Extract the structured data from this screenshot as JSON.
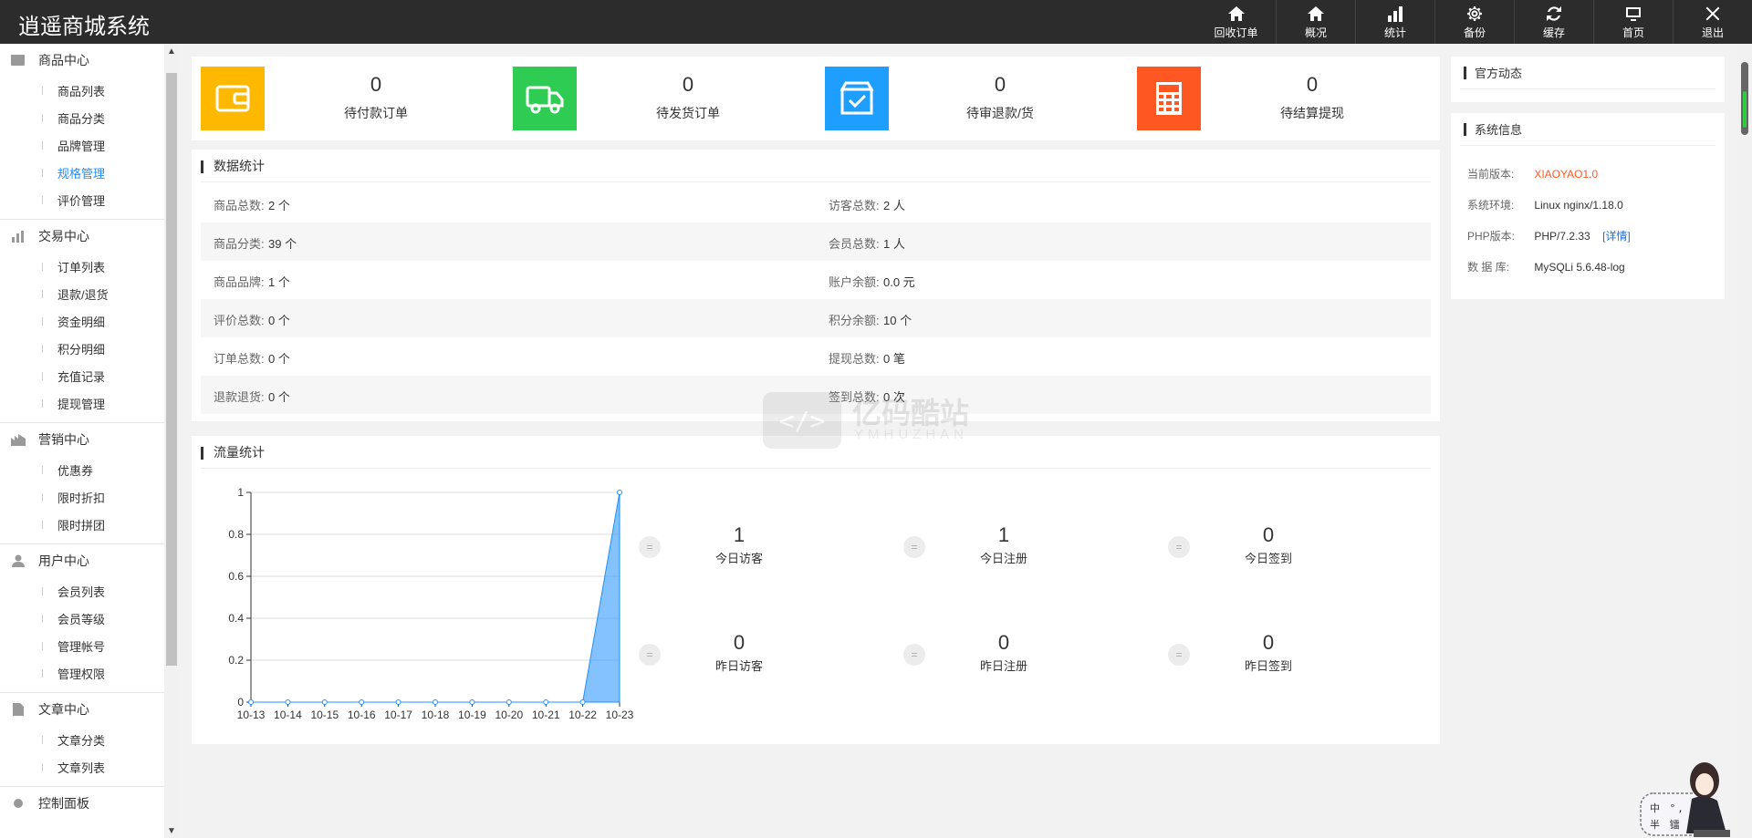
{
  "app": {
    "title": "逍遥商城系统"
  },
  "topnav": [
    {
      "label": "回收订单",
      "icon": "home-icon"
    },
    {
      "label": "概况",
      "icon": "home-icon"
    },
    {
      "label": "统计",
      "icon": "bar-chart-icon"
    },
    {
      "label": "备份",
      "icon": "gear-icon"
    },
    {
      "label": "缓存",
      "icon": "refresh-icon"
    },
    {
      "label": "首页",
      "icon": "monitor-icon"
    },
    {
      "label": "退出",
      "icon": "close-icon"
    }
  ],
  "sidebar": {
    "groups": [
      {
        "title": "商品中心",
        "icon": "goods-icon",
        "items": [
          "商品列表",
          "商品分类",
          "品牌管理",
          "规格管理",
          "评价管理"
        ],
        "active": "规格管理"
      },
      {
        "title": "交易中心",
        "icon": "bar-chart-icon",
        "items": [
          "订单列表",
          "退款/退货",
          "资金明细",
          "积分明细",
          "充值记录",
          "提现管理"
        ]
      },
      {
        "title": "营销中心",
        "icon": "marketing-icon",
        "items": [
          "优惠券",
          "限时折扣",
          "限时拼团"
        ]
      },
      {
        "title": "用户中心",
        "icon": "user-icon",
        "items": [
          "会员列表",
          "会员等级",
          "管理帐号",
          "管理权限"
        ]
      },
      {
        "title": "文章中心",
        "icon": "document-icon",
        "items": [
          "文章分类",
          "文章列表"
        ]
      },
      {
        "title": "控制面板",
        "icon": "gear-icon",
        "items": []
      }
    ]
  },
  "pending": [
    {
      "value": "0",
      "label": "待付款订单",
      "color": "#ffb800",
      "icon": "wallet-icon"
    },
    {
      "value": "0",
      "label": "待发货订单",
      "color": "#2ecc52",
      "icon": "truck-icon"
    },
    {
      "value": "0",
      "label": "待审退款/货",
      "color": "#1e9fff",
      "icon": "checkbox-icon"
    },
    {
      "value": "0",
      "label": "待结算提现",
      "color": "#ff5722",
      "icon": "calculator-icon"
    }
  ],
  "data_stats": {
    "title": "数据统计",
    "rows": [
      {
        "left_label": "商品总数:",
        "left_value": "2 个",
        "right_label": "访客总数:",
        "right_value": "2 人"
      },
      {
        "left_label": "商品分类:",
        "left_value": "39 个",
        "right_label": "会员总数:",
        "right_value": "1 人"
      },
      {
        "left_label": "商品品牌:",
        "left_value": "1 个",
        "right_label": "账户余额:",
        "right_value": "0.0 元"
      },
      {
        "left_label": "评价总数:",
        "left_value": "0 个",
        "right_label": "积分余额:",
        "right_value": "10 个"
      },
      {
        "left_label": "订单总数:",
        "left_value": "0 个",
        "right_label": "提现总数:",
        "right_value": "0 笔"
      },
      {
        "left_label": "退款退货:",
        "left_value": "0 个",
        "right_label": "签到总数:",
        "right_value": "0 次"
      }
    ]
  },
  "traffic": {
    "title": "流量统计",
    "stats": [
      {
        "value": "1",
        "label": "今日访客"
      },
      {
        "value": "1",
        "label": "今日注册"
      },
      {
        "value": "0",
        "label": "今日签到"
      },
      {
        "value": "0",
        "label": "昨日访客"
      },
      {
        "value": "0",
        "label": "昨日注册"
      },
      {
        "value": "0",
        "label": "昨日签到"
      }
    ],
    "badge": "="
  },
  "chart_data": {
    "type": "area",
    "title": "",
    "xlabel": "",
    "ylabel": "",
    "x": [
      "10-13",
      "10-14",
      "10-15",
      "10-16",
      "10-17",
      "10-18",
      "10-19",
      "10-20",
      "10-21",
      "10-22",
      "10-23"
    ],
    "values": [
      0,
      0,
      0,
      0,
      0,
      0,
      0,
      0,
      0,
      0,
      1
    ],
    "ylim": [
      0,
      1
    ],
    "yticks": [
      "0",
      "0.2",
      "0.4",
      "0.6",
      "0.8",
      "1"
    ],
    "grid": true,
    "color": "#1e90ff"
  },
  "news": {
    "title": "官方动态"
  },
  "sysinfo": {
    "title": "系统信息",
    "rows": [
      {
        "label": "当前版本:",
        "value": "XIAOYAO1.0",
        "accent": true
      },
      {
        "label": "系统环境:",
        "value": "Linux nginx/1.18.0"
      },
      {
        "label": "PHP版本:",
        "value": "PHP/7.2.33",
        "link": "[详情]"
      },
      {
        "label": "数 据 库:",
        "value": "MySQLi 5.6.48-log"
      }
    ]
  },
  "watermark": {
    "cn": "亿码酷站",
    "en": "YMHUZHAN",
    "mark": "</>"
  },
  "mascot": {
    "text": "中 °, 半 镭"
  }
}
